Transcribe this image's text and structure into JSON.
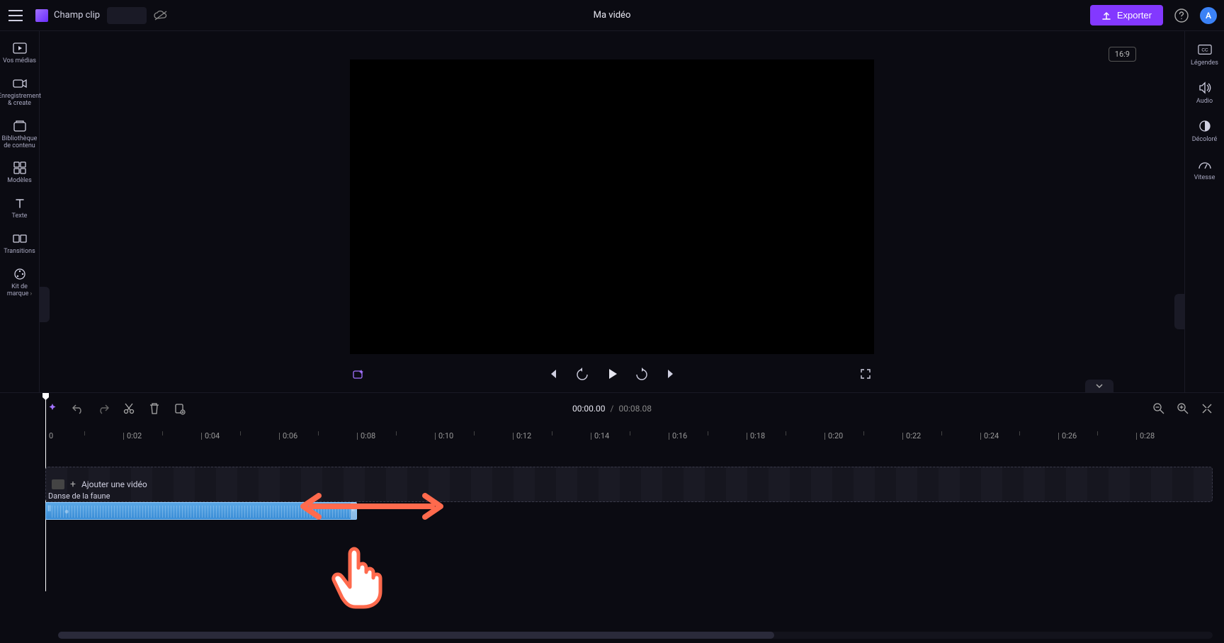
{
  "header": {
    "clip_field_label": "Champ clip",
    "title": "Ma vidéo",
    "export_label": "Exporter",
    "avatar_initial": "A",
    "aspect_badge": "16:9"
  },
  "left_sidebar": {
    "items": [
      {
        "name": "your-media",
        "label": "Vos médias",
        "icon": "media-icon"
      },
      {
        "name": "record-create",
        "label": "Enregistrement &amp; create",
        "icon": "camera-icon"
      },
      {
        "name": "content-lib",
        "label": "Bibliothèque de contenu",
        "icon": "library-icon"
      },
      {
        "name": "templates",
        "label": "Modèles",
        "icon": "templates-icon"
      },
      {
        "name": "text",
        "label": "Texte",
        "icon": "text-icon"
      },
      {
        "name": "transitions",
        "label": "Transitions",
        "icon": "transitions-icon"
      },
      {
        "name": "brand-kit",
        "label": "Kit de marque",
        "icon": "brandkit-icon",
        "chevron": true
      }
    ]
  },
  "right_sidebar": {
    "items": [
      {
        "name": "captions",
        "label": "Légendes",
        "icon": "cc-icon"
      },
      {
        "name": "audio",
        "label": "Audio",
        "icon": "speaker-icon"
      },
      {
        "name": "fade",
        "label": "Décoloré",
        "icon": "circle-half-icon"
      },
      {
        "name": "speed",
        "label": "Vitesse",
        "icon": "gauge-icon"
      }
    ]
  },
  "playback": {
    "current_time": "00:00.00",
    "duration": "00:08.08"
  },
  "ruler": {
    "ticks": [
      "0",
      "0:02",
      "0:04",
      "0:06",
      "0:08",
      "0:10",
      "0:12",
      "0:14",
      "0:16",
      "0:18",
      "0:20",
      "0:22",
      "0:24",
      "0:26",
      "0:28"
    ]
  },
  "tracks": {
    "video_placeholder": "Ajouter une vidéo",
    "audio_clip_title": "Danse de la faune"
  }
}
